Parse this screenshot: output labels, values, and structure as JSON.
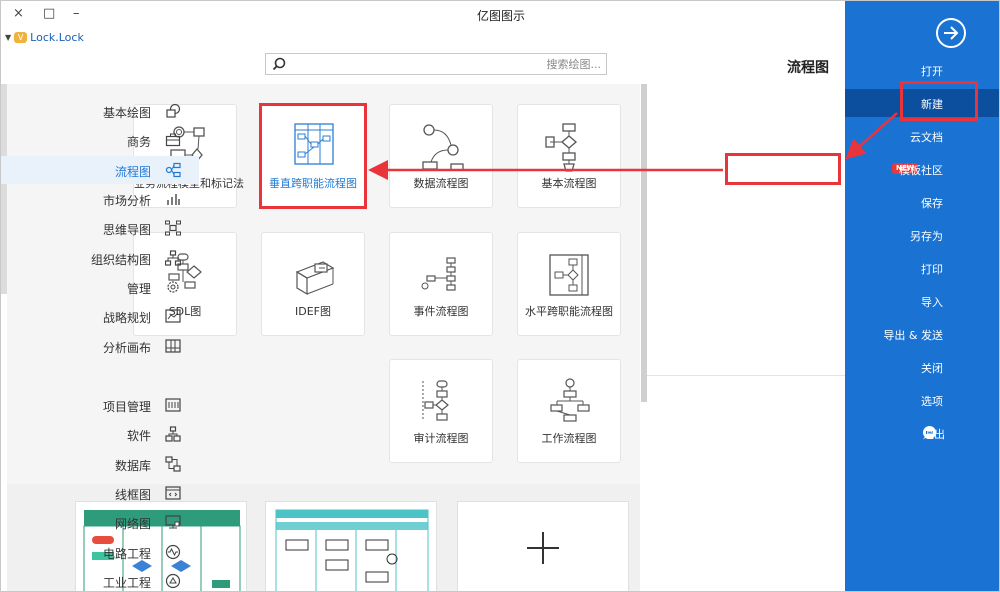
{
  "window": {
    "title": "亿图图示",
    "close_icon": "×",
    "max_icon": "□",
    "min_icon": "–"
  },
  "user": {
    "name": "Lock.Lock",
    "dropdown": "▼",
    "vip_badge": "V"
  },
  "search": {
    "placeholder": "搜索绘图..."
  },
  "section_title": "流程图",
  "templates": [
    {
      "label": "基本流程图"
    },
    {
      "label": "数据流程图"
    },
    {
      "label": "垂直跨职能流程图"
    },
    {
      "label": "业务流程模型和标记法"
    },
    {
      "label": "水平跨职能流程图"
    },
    {
      "label": "事件流程图"
    },
    {
      "label": "IDEF图"
    },
    {
      "label": "SDL图"
    },
    {
      "label": "工作流程图"
    },
    {
      "label": "审计流程图"
    }
  ],
  "categories": [
    {
      "label": "基本绘图"
    },
    {
      "label": "商务"
    },
    {
      "label": "流程图"
    },
    {
      "label": "市场分析"
    },
    {
      "label": "思维导图"
    },
    {
      "label": "组织结构图"
    },
    {
      "label": "管理"
    },
    {
      "label": "战略规划"
    },
    {
      "label": "分析画布"
    },
    {
      "label": "项目管理"
    },
    {
      "label": "软件"
    },
    {
      "label": "数据库"
    },
    {
      "label": "线框图"
    },
    {
      "label": "网络图"
    },
    {
      "label": "电路工程"
    },
    {
      "label": "工业工程"
    }
  ],
  "sidebar": {
    "items": [
      {
        "label": "打开"
      },
      {
        "label": "新建"
      },
      {
        "label": "云文档"
      },
      {
        "label": "模板社区",
        "badge": "NEW"
      },
      {
        "label": "保存"
      },
      {
        "label": "另存为"
      },
      {
        "label": "打印"
      },
      {
        "label": "导入"
      },
      {
        "label": "导出 & 发送"
      },
      {
        "label": "关闭"
      },
      {
        "label": "选项"
      },
      {
        "label": "退出"
      }
    ]
  },
  "samples": {
    "add_label": "+"
  },
  "colors": {
    "sidebar": "#1a73d3",
    "sidebar_active": "#0b4f9e",
    "highlight": "#e8343a",
    "link": "#1f7ad7"
  }
}
